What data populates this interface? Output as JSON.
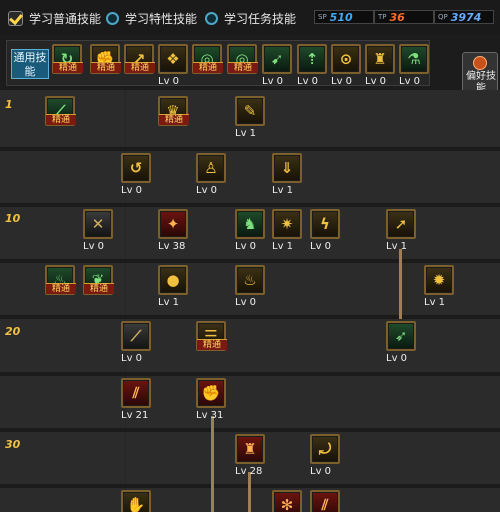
{
  "tabs": [
    {
      "label": "学习普通技能",
      "selected": true
    },
    {
      "label": "学习特性技能",
      "selected": false
    },
    {
      "label": "学习任务技能",
      "selected": false
    }
  ],
  "points": [
    {
      "label": "SP",
      "value": "510",
      "color": "#3fa9f5"
    },
    {
      "label": "TP",
      "value": "36",
      "color": "#ff6a2a"
    },
    {
      "label": "QP",
      "value": "3974",
      "color": "#66aaff"
    }
  ],
  "common_label": "通用技能",
  "side_button_label": "偏好技能",
  "levels": [
    "1",
    "10",
    "20",
    "30"
  ],
  "common_skills": [
    {
      "icon": "refresh-icon",
      "glyph": "↻",
      "color": "green",
      "label": "精通"
    },
    {
      "icon": "punch-icon",
      "glyph": "✊",
      "color": "gold",
      "label": "精通"
    },
    {
      "icon": "jump-icon",
      "glyph": "↗",
      "color": "gold",
      "label": "精通"
    },
    {
      "icon": "wings-icon",
      "glyph": "❖",
      "color": "gold",
      "label": "Lv 0"
    },
    {
      "icon": "target-icon",
      "glyph": "◎",
      "color": "green",
      "label": "精通"
    },
    {
      "icon": "target-icon",
      "glyph": "◎",
      "color": "green",
      "label": "精通"
    },
    {
      "icon": "run-icon",
      "glyph": "➹",
      "color": "green",
      "label": "Lv 0"
    },
    {
      "icon": "arrow-icon",
      "glyph": "⇡",
      "color": "green",
      "label": "Lv 0"
    },
    {
      "icon": "shield-icon",
      "glyph": "⊙",
      "color": "gold",
      "label": "Lv 0"
    },
    {
      "icon": "figure-icon",
      "glyph": "♜",
      "color": "gold",
      "label": "Lv 0"
    },
    {
      "icon": "potion-icon",
      "glyph": "⚗",
      "color": "green",
      "label": "Lv 0"
    }
  ],
  "skills": [
    {
      "icon": "slash-icon",
      "glyph": "⟋",
      "color": "green",
      "label": "精通"
    },
    {
      "icon": "cup-icon",
      "glyph": "♛",
      "color": "gold",
      "label": "精通"
    },
    {
      "icon": "sword-icon",
      "glyph": "✎",
      "color": "gold",
      "label": "Lv 1"
    },
    {
      "icon": "spin-icon",
      "glyph": "↺",
      "color": "gold",
      "label": "Lv 0"
    },
    {
      "icon": "body-icon",
      "glyph": "♙",
      "color": "gold",
      "label": "Lv 0"
    },
    {
      "icon": "down-arrow-icon",
      "glyph": "⇓",
      "color": "gold",
      "label": "Lv 1"
    },
    {
      "icon": "cross-icon",
      "glyph": "✕",
      "color": "dark",
      "label": "Lv 0"
    },
    {
      "icon": "fire-icon",
      "glyph": "✦",
      "color": "red",
      "label": "Lv 38"
    },
    {
      "icon": "golem-icon",
      "glyph": "♞",
      "color": "green",
      "label": "Lv 0"
    },
    {
      "icon": "burst-icon",
      "glyph": "✷",
      "color": "gold",
      "label": "Lv 1"
    },
    {
      "icon": "kick-icon",
      "glyph": "ϟ",
      "color": "gold",
      "label": "Lv 0"
    },
    {
      "icon": "strike-icon",
      "glyph": "➚",
      "color": "gold",
      "label": "Lv 1"
    },
    {
      "icon": "flame-icon",
      "glyph": "♨",
      "color": "green",
      "label": "精通"
    },
    {
      "icon": "leaf-icon",
      "glyph": "❦",
      "color": "green",
      "label": "精通"
    },
    {
      "icon": "bomb-icon",
      "glyph": "●",
      "color": "gold",
      "label": "Lv 1"
    },
    {
      "icon": "fire-drop-icon",
      "glyph": "♨",
      "color": "gold",
      "label": "Lv 0"
    },
    {
      "icon": "explosion-icon",
      "glyph": "✹",
      "color": "gold",
      "label": "Lv 1"
    },
    {
      "icon": "blade-icon",
      "glyph": "⟋",
      "color": "dark",
      "label": "Lv 0"
    },
    {
      "icon": "scroll-icon",
      "glyph": "☰",
      "color": "gold",
      "label": "精通"
    },
    {
      "icon": "dash-icon",
      "glyph": "➶",
      "color": "green",
      "label": "Lv 0"
    },
    {
      "icon": "claw-icon",
      "glyph": "⫽",
      "color": "red",
      "label": "Lv 21"
    },
    {
      "icon": "fist-icon",
      "glyph": "✊",
      "color": "red",
      "label": "Lv 31"
    },
    {
      "icon": "vase-icon",
      "glyph": "♜",
      "color": "red",
      "label": "Lv 28"
    },
    {
      "icon": "hook-icon",
      "glyph": "⤾",
      "color": "gold",
      "label": "Lv 0"
    },
    {
      "icon": "hand-icon",
      "glyph": "✋",
      "color": "gold",
      "label": ""
    },
    {
      "icon": "web-icon",
      "glyph": "✻",
      "color": "red",
      "label": ""
    },
    {
      "icon": "claw-icon",
      "glyph": "⫽",
      "color": "red",
      "label": ""
    }
  ]
}
